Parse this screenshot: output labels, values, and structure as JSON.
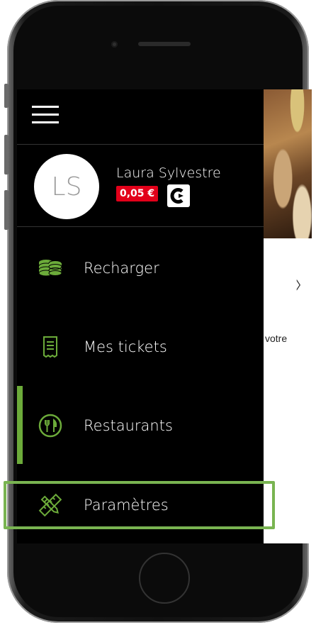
{
  "user": {
    "initials": "LS",
    "name": "Laura Sylvestre",
    "balance": "0,05 €",
    "brand_letter": "C"
  },
  "menu": {
    "items": [
      {
        "label": "Recharger",
        "icon": "coins-icon"
      },
      {
        "label": "Mes tickets",
        "icon": "ticket-icon"
      },
      {
        "label": "Restaurants",
        "icon": "restaurant-icon"
      },
      {
        "label": "Paramètres",
        "icon": "settings-tools-icon"
      }
    ],
    "active": "Restaurants",
    "highlighted": "Paramètres"
  },
  "background": {
    "partial_text": "votre"
  },
  "colors": {
    "accent_green": "#6cab3a",
    "highlight_green": "#79b451",
    "balance_red": "#e2001a",
    "drawer_bg": "#000000"
  }
}
